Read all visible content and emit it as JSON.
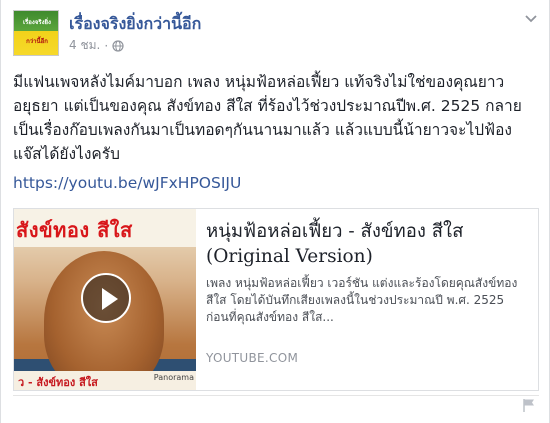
{
  "header": {
    "page_name": "เรื่องจริงยิ่งกว่านี้อีก",
    "timestamp": "4 ชม.",
    "avatar_line1": "เรื่องจริงยิ่ง",
    "avatar_line2": "กว่านี้อีก",
    "privacy_icon": "globe-icon",
    "menu_icon": "chevron-down-icon"
  },
  "post": {
    "text": "มีแฟนเพจหลังไมค์มาบอก เพลง หนุ่มฟ้อหล่อเฟี้ยว แท้จริงไม่ใช่ของคุณยาวอยุธยา แต่เป็นของคุณ สังข์ทอง สีใส ที่ร้องไว้ช่วงประมาณปีพ.ศ. 2525 กลายเป็นเรื่องก๊อบเพลงกันมาเป็นทอดๆกันนานมาแล้ว แล้วแบบนี้น้ายาวจะไปฟ้องแจ๊สได้ยังไงครับ",
    "link": "https://youtu.be/wJFxHPOSIJU"
  },
  "preview": {
    "thumb_title": "สังข์ทอง สีใส",
    "thumb_caption": "ว - สังข์ทอง สีใส",
    "thumb_watermark": "Panorama",
    "title": "หนุ่มฟ้อหล่อเฟี้ยว - สังข์ทอง สีใส (Original Version)",
    "description": "เพลง หนุ่มฟ้อหล่อเฟี้ยว เวอร์ชัน แต่งและร้องโดยคุณสังข์ทอง สีใส โดยได้บันทึกเสียงเพลงนี้ในช่วงประมาณปี พ.ศ. 2525 ก่อนที่คุณสังข์ทอง สีใส...",
    "domain": "YOUTUBE.COM",
    "play_icon": "play-icon"
  },
  "footer": {
    "flag_icon": "flag-icon"
  },
  "colors": {
    "link": "#365899",
    "text": "#1d2129",
    "muted": "#90949c",
    "border": "#dddfe2"
  }
}
